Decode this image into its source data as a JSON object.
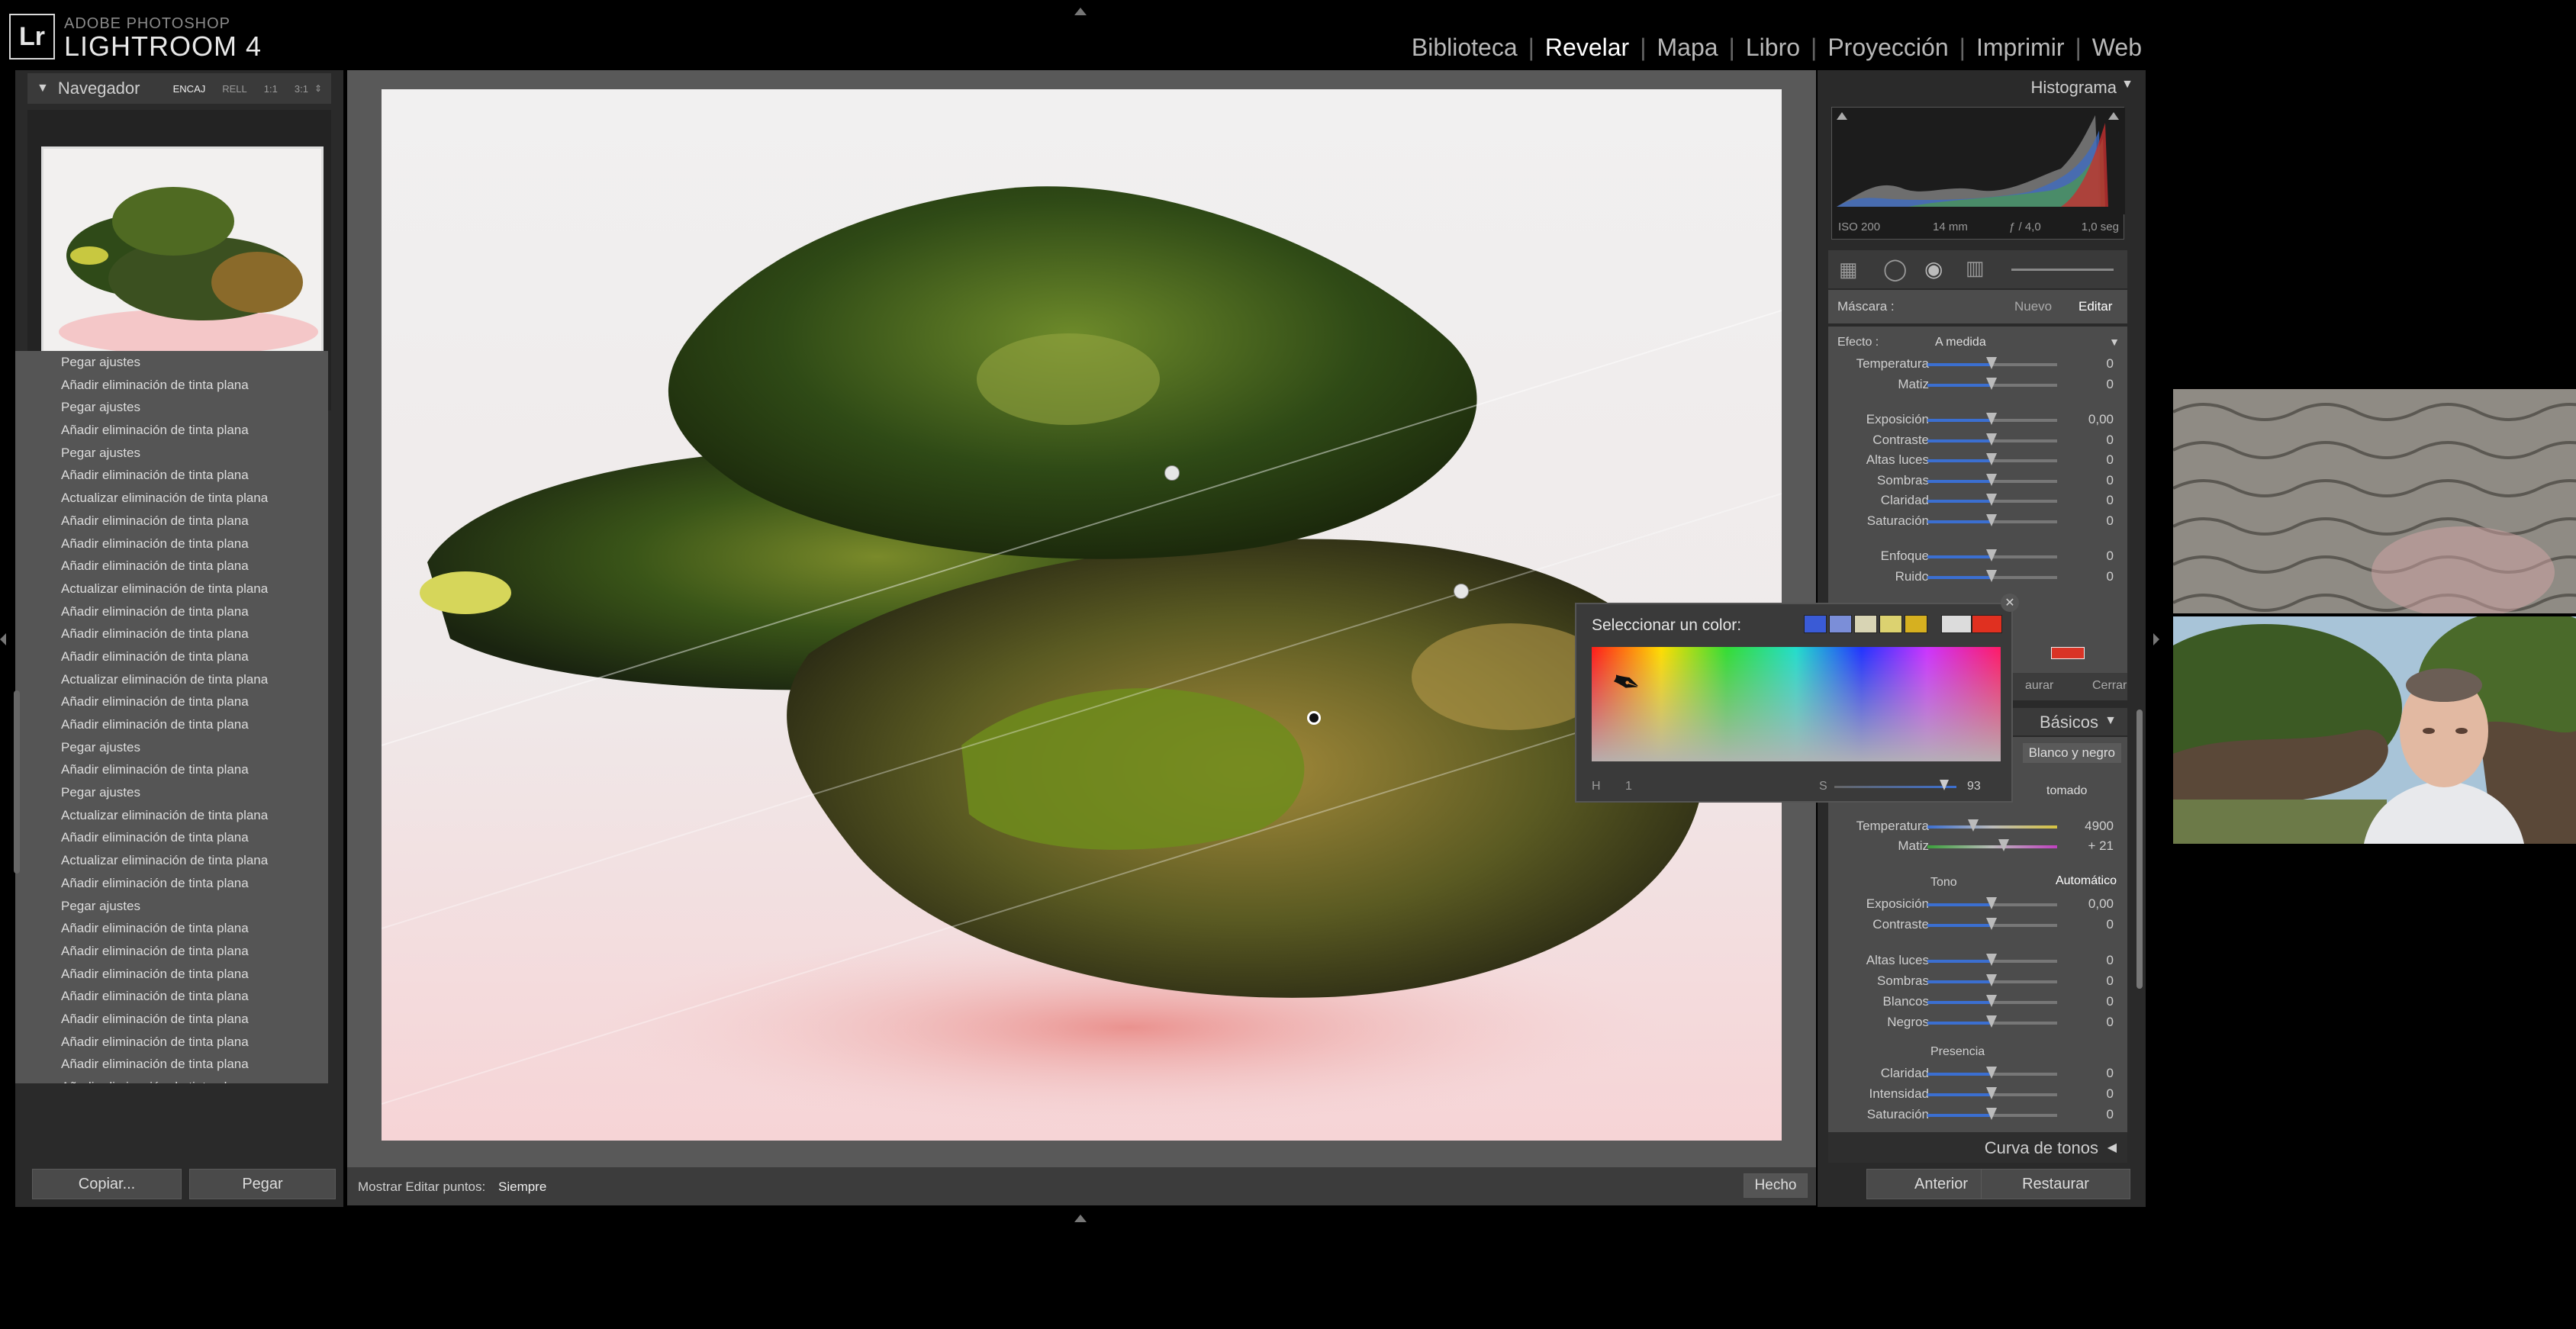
{
  "app": {
    "brand_small": "ADOBE PHOTOSHOP",
    "brand_big": "LIGHTROOM 4",
    "logo": "Lr"
  },
  "modules": [
    {
      "label": "Biblioteca"
    },
    {
      "label": "Revelar",
      "active": true
    },
    {
      "label": "Mapa"
    },
    {
      "label": "Libro"
    },
    {
      "label": "Proyección"
    },
    {
      "label": "Imprimir"
    },
    {
      "label": "Web"
    }
  ],
  "navigator": {
    "title": "Navegador",
    "zoom_options": [
      "ENCAJ",
      "RELL",
      "1:1",
      "3:1"
    ]
  },
  "history": [
    "Pegar ajustes",
    "Añadir eliminación de tinta plana",
    "Pegar ajustes",
    "Añadir eliminación de tinta plana",
    "Pegar ajustes",
    "Añadir eliminación de tinta plana",
    "Actualizar eliminación de tinta plana",
    "Añadir eliminación de tinta plana",
    "Añadir eliminación de tinta plana",
    "Añadir eliminación de tinta plana",
    "Actualizar eliminación de tinta plana",
    "Añadir eliminación de tinta plana",
    "Añadir eliminación de tinta plana",
    "Añadir eliminación de tinta plana",
    "Actualizar eliminación de tinta plana",
    "Añadir eliminación de tinta plana",
    "Añadir eliminación de tinta plana",
    "Pegar ajustes",
    "Añadir eliminación de tinta plana",
    "Pegar ajustes",
    "Actualizar eliminación de tinta plana",
    "Añadir eliminación de tinta plana",
    "Actualizar eliminación de tinta plana",
    "Añadir eliminación de tinta plana",
    "Pegar ajustes",
    "Añadir eliminación de tinta plana",
    "Añadir eliminación de tinta plana",
    "Añadir eliminación de tinta plana",
    "Añadir eliminación de tinta plana",
    "Añadir eliminación de tinta plana",
    "Añadir eliminación de tinta plana",
    "Añadir eliminación de tinta plana",
    "Añadir eliminación de tinta plana"
  ],
  "left_buttons": {
    "copy": "Copiar...",
    "paste": "Pegar"
  },
  "toolbar": {
    "show_points_label": "Mostrar Editar puntos:",
    "show_points_value": "Siempre",
    "done": "Hecho"
  },
  "histogram": {
    "title": "Histograma",
    "iso": "ISO 200",
    "focal": "14 mm",
    "aperture": "ƒ / 4,0",
    "shutter": "1,0 seg"
  },
  "mask": {
    "label": "Máscara :",
    "new": "Nuevo",
    "edit": "Editar",
    "effect_label": "Efecto :",
    "effect_value": "A medida"
  },
  "mask_sliders": [
    {
      "label": "Temperatura",
      "value": "0"
    },
    {
      "label": "Matiz",
      "value": "0"
    },
    {
      "label": "Exposición",
      "value": "0,00"
    },
    {
      "label": "Contraste",
      "value": "0"
    },
    {
      "label": "Altas luces",
      "value": "0"
    },
    {
      "label": "Sombras",
      "value": "0"
    },
    {
      "label": "Claridad",
      "value": "0"
    },
    {
      "label": "Saturación",
      "value": "0"
    },
    {
      "label": "Enfoque",
      "value": "0"
    },
    {
      "label": "Ruido",
      "value": "0"
    }
  ],
  "mask_footer": {
    "restore": "aurar",
    "close": "Cerrar"
  },
  "basic": {
    "title": "Básicos",
    "bw": "Blanco y negro",
    "wb_value": "tomado",
    "temp": {
      "label": "Temperatura",
      "value": "4900"
    },
    "tint": {
      "label": "Matiz",
      "value": "+ 21"
    },
    "tone_label": "Tono",
    "auto": "Automático",
    "tone_sliders": [
      {
        "label": "Exposición",
        "value": "0,00"
      },
      {
        "label": "Contraste",
        "value": "0"
      },
      {
        "label": "Altas luces",
        "value": "0"
      },
      {
        "label": "Sombras",
        "value": "0"
      },
      {
        "label": "Blancos",
        "value": "0"
      },
      {
        "label": "Negros",
        "value": "0"
      }
    ],
    "presence_label": "Presencia",
    "presence_sliders": [
      {
        "label": "Claridad",
        "value": "0"
      },
      {
        "label": "Intensidad",
        "value": "0"
      },
      {
        "label": "Saturación",
        "value": "0"
      }
    ]
  },
  "tone_curve": {
    "title": "Curva de tonos"
  },
  "right_buttons": {
    "previous": "Anterior",
    "reset": "Restaurar"
  },
  "color_picker": {
    "title": "Seleccionar un color:",
    "h_label": "H",
    "h_value": "1",
    "s_label": "S",
    "s_value": "93",
    "swatches": [
      "#3a5bd6",
      "#7b8ed8",
      "#d8d4b4",
      "#dcd270",
      "#d6b020"
    ],
    "current_colors": [
      "#dcdcdc",
      "#e03020"
    ]
  },
  "colors": {
    "accent_slider": "#3b6fd1",
    "picked_color": "#d93426"
  }
}
